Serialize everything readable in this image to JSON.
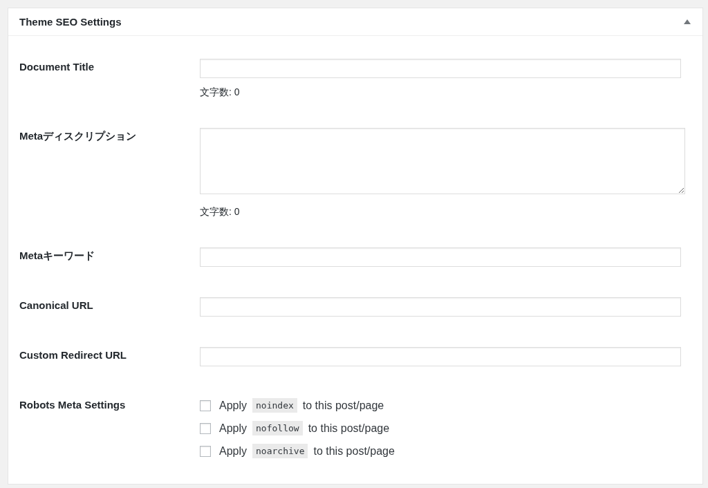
{
  "panel": {
    "title": "Theme SEO Settings",
    "expanded": true
  },
  "fields": [
    {
      "kind": "text",
      "label": "Document Title",
      "char_count": "文字数: 0"
    },
    {
      "kind": "textarea",
      "label": "Metaディスクリプション",
      "char_count": "文字数: 0"
    },
    {
      "kind": "text",
      "label": "Metaキーワード"
    },
    {
      "kind": "text",
      "label": "Canonical URL"
    },
    {
      "kind": "text",
      "label": "Custom Redirect URL"
    },
    {
      "kind": "checkboxes",
      "label": "Robots Meta Settings",
      "options": [
        {
          "prefix": "Apply",
          "code": "noindex",
          "suffix": "to this post/page",
          "checked": false
        },
        {
          "prefix": "Apply",
          "code": "nofollow",
          "suffix": "to this post/page",
          "checked": false
        },
        {
          "prefix": "Apply",
          "code": "noarchive",
          "suffix": "to this post/page",
          "checked": false
        }
      ]
    }
  ]
}
